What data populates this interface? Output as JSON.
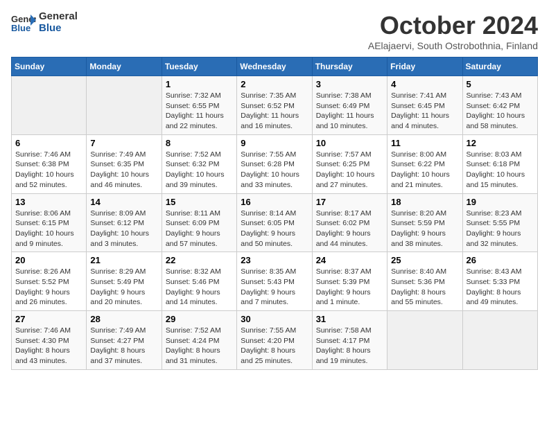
{
  "header": {
    "logo_line1": "General",
    "logo_line2": "Blue",
    "month": "October 2024",
    "location": "AElajaervi, South Ostrobothnia, Finland"
  },
  "days_of_week": [
    "Sunday",
    "Monday",
    "Tuesday",
    "Wednesday",
    "Thursday",
    "Friday",
    "Saturday"
  ],
  "weeks": [
    [
      {
        "day": "",
        "content": ""
      },
      {
        "day": "",
        "content": ""
      },
      {
        "day": "1",
        "content": "Sunrise: 7:32 AM\nSunset: 6:55 PM\nDaylight: 11 hours and 22 minutes."
      },
      {
        "day": "2",
        "content": "Sunrise: 7:35 AM\nSunset: 6:52 PM\nDaylight: 11 hours and 16 minutes."
      },
      {
        "day": "3",
        "content": "Sunrise: 7:38 AM\nSunset: 6:49 PM\nDaylight: 11 hours and 10 minutes."
      },
      {
        "day": "4",
        "content": "Sunrise: 7:41 AM\nSunset: 6:45 PM\nDaylight: 11 hours and 4 minutes."
      },
      {
        "day": "5",
        "content": "Sunrise: 7:43 AM\nSunset: 6:42 PM\nDaylight: 10 hours and 58 minutes."
      }
    ],
    [
      {
        "day": "6",
        "content": "Sunrise: 7:46 AM\nSunset: 6:38 PM\nDaylight: 10 hours and 52 minutes."
      },
      {
        "day": "7",
        "content": "Sunrise: 7:49 AM\nSunset: 6:35 PM\nDaylight: 10 hours and 46 minutes."
      },
      {
        "day": "8",
        "content": "Sunrise: 7:52 AM\nSunset: 6:32 PM\nDaylight: 10 hours and 39 minutes."
      },
      {
        "day": "9",
        "content": "Sunrise: 7:55 AM\nSunset: 6:28 PM\nDaylight: 10 hours and 33 minutes."
      },
      {
        "day": "10",
        "content": "Sunrise: 7:57 AM\nSunset: 6:25 PM\nDaylight: 10 hours and 27 minutes."
      },
      {
        "day": "11",
        "content": "Sunrise: 8:00 AM\nSunset: 6:22 PM\nDaylight: 10 hours and 21 minutes."
      },
      {
        "day": "12",
        "content": "Sunrise: 8:03 AM\nSunset: 6:18 PM\nDaylight: 10 hours and 15 minutes."
      }
    ],
    [
      {
        "day": "13",
        "content": "Sunrise: 8:06 AM\nSunset: 6:15 PM\nDaylight: 10 hours and 9 minutes."
      },
      {
        "day": "14",
        "content": "Sunrise: 8:09 AM\nSunset: 6:12 PM\nDaylight: 10 hours and 3 minutes."
      },
      {
        "day": "15",
        "content": "Sunrise: 8:11 AM\nSunset: 6:09 PM\nDaylight: 9 hours and 57 minutes."
      },
      {
        "day": "16",
        "content": "Sunrise: 8:14 AM\nSunset: 6:05 PM\nDaylight: 9 hours and 50 minutes."
      },
      {
        "day": "17",
        "content": "Sunrise: 8:17 AM\nSunset: 6:02 PM\nDaylight: 9 hours and 44 minutes."
      },
      {
        "day": "18",
        "content": "Sunrise: 8:20 AM\nSunset: 5:59 PM\nDaylight: 9 hours and 38 minutes."
      },
      {
        "day": "19",
        "content": "Sunrise: 8:23 AM\nSunset: 5:55 PM\nDaylight: 9 hours and 32 minutes."
      }
    ],
    [
      {
        "day": "20",
        "content": "Sunrise: 8:26 AM\nSunset: 5:52 PM\nDaylight: 9 hours and 26 minutes."
      },
      {
        "day": "21",
        "content": "Sunrise: 8:29 AM\nSunset: 5:49 PM\nDaylight: 9 hours and 20 minutes."
      },
      {
        "day": "22",
        "content": "Sunrise: 8:32 AM\nSunset: 5:46 PM\nDaylight: 9 hours and 14 minutes."
      },
      {
        "day": "23",
        "content": "Sunrise: 8:35 AM\nSunset: 5:43 PM\nDaylight: 9 hours and 7 minutes."
      },
      {
        "day": "24",
        "content": "Sunrise: 8:37 AM\nSunset: 5:39 PM\nDaylight: 9 hours and 1 minute."
      },
      {
        "day": "25",
        "content": "Sunrise: 8:40 AM\nSunset: 5:36 PM\nDaylight: 8 hours and 55 minutes."
      },
      {
        "day": "26",
        "content": "Sunrise: 8:43 AM\nSunset: 5:33 PM\nDaylight: 8 hours and 49 minutes."
      }
    ],
    [
      {
        "day": "27",
        "content": "Sunrise: 7:46 AM\nSunset: 4:30 PM\nDaylight: 8 hours and 43 minutes."
      },
      {
        "day": "28",
        "content": "Sunrise: 7:49 AM\nSunset: 4:27 PM\nDaylight: 8 hours and 37 minutes."
      },
      {
        "day": "29",
        "content": "Sunrise: 7:52 AM\nSunset: 4:24 PM\nDaylight: 8 hours and 31 minutes."
      },
      {
        "day": "30",
        "content": "Sunrise: 7:55 AM\nSunset: 4:20 PM\nDaylight: 8 hours and 25 minutes."
      },
      {
        "day": "31",
        "content": "Sunrise: 7:58 AM\nSunset: 4:17 PM\nDaylight: 8 hours and 19 minutes."
      },
      {
        "day": "",
        "content": ""
      },
      {
        "day": "",
        "content": ""
      }
    ]
  ]
}
